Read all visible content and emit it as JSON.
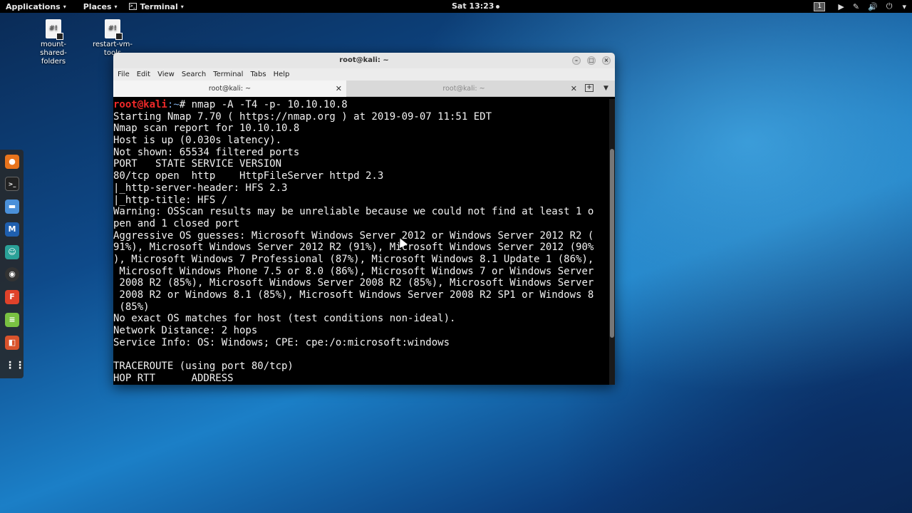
{
  "top_panel": {
    "applications": "Applications",
    "places": "Places",
    "terminal": "Terminal",
    "clock": "Sat 13:23",
    "workspace": "1"
  },
  "desktop": {
    "icons": [
      {
        "label": "mount-shared-folders",
        "glyph": "#!"
      },
      {
        "label": "restart-vm-tools",
        "glyph": "#!"
      }
    ]
  },
  "dock": {
    "items": [
      "firefox-icon",
      "terminal-icon",
      "files-icon",
      "metasploit-icon",
      "armitage-icon",
      "faraday-icon",
      "burpsuite-icon",
      "leafpad-icon",
      "maltego-icon",
      "show-apps-icon"
    ]
  },
  "window": {
    "title": "root@kali: ~",
    "menu": [
      "File",
      "Edit",
      "View",
      "Search",
      "Terminal",
      "Tabs",
      "Help"
    ],
    "tabs": [
      {
        "label": "root@kali: ~",
        "active": true
      },
      {
        "label": "root@kali: ~",
        "active": false
      }
    ]
  },
  "terminal": {
    "prompt_user": "root@kali",
    "prompt_path": ":~",
    "prompt_symbol": "# ",
    "command": "nmap -A -T4 -p- 10.10.10.8",
    "output": [
      "Starting Nmap 7.70 ( https://nmap.org ) at 2019-09-07 11:51 EDT",
      "Nmap scan report for 10.10.10.8",
      "Host is up (0.030s latency).",
      "Not shown: 65534 filtered ports",
      "PORT   STATE SERVICE VERSION",
      "80/tcp open  http    HttpFileServer httpd 2.3",
      "|_http-server-header: HFS 2.3",
      "|_http-title: HFS /",
      "Warning: OSScan results may be unreliable because we could not find at least 1 o",
      "pen and 1 closed port",
      "Aggressive OS guesses: Microsoft Windows Server 2012 or Windows Server 2012 R2 (",
      "91%), Microsoft Windows Server 2012 R2 (91%), Microsoft Windows Server 2012 (90%",
      "), Microsoft Windows 7 Professional (87%), Microsoft Windows 8.1 Update 1 (86%),",
      " Microsoft Windows Phone 7.5 or 8.0 (86%), Microsoft Windows 7 or Windows Server",
      " 2008 R2 (85%), Microsoft Windows Server 2008 R2 (85%), Microsoft Windows Server",
      " 2008 R2 or Windows 8.1 (85%), Microsoft Windows Server 2008 R2 SP1 or Windows 8",
      " (85%)",
      "No exact OS matches for host (test conditions non-ideal).",
      "Network Distance: 2 hops",
      "Service Info: OS: Windows; CPE: cpe:/o:microsoft:windows",
      "",
      "TRACEROUTE (using port 80/tcp)",
      "HOP RTT      ADDRESS"
    ]
  }
}
